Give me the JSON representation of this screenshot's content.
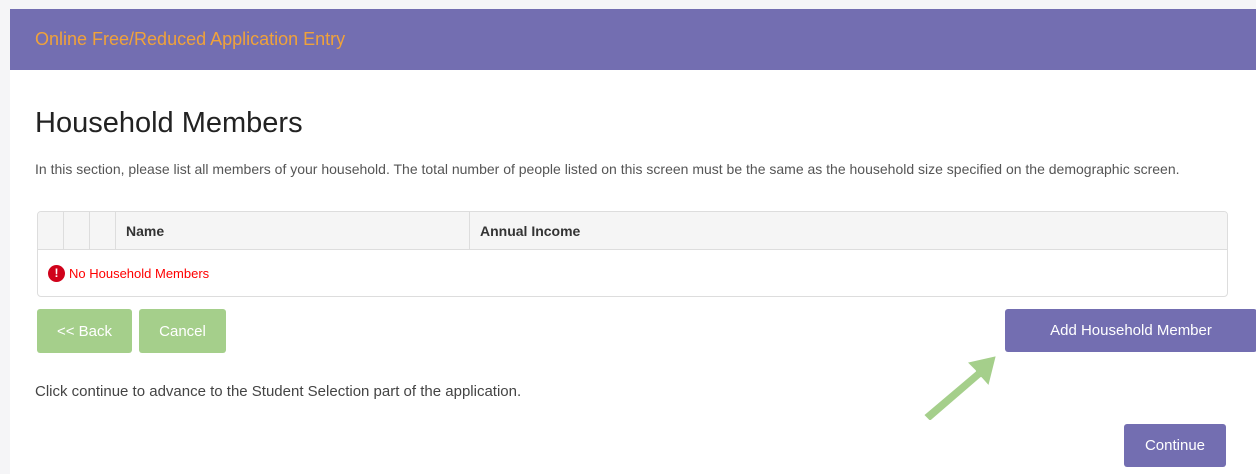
{
  "header": {
    "title": "Online Free/Reduced Application Entry"
  },
  "page": {
    "title": "Household Members",
    "intro": "In this section, please list all members of your household. The total number of people listed on this screen must be the same as the household size specified on the demographic screen.",
    "hint": "Click continue to advance to the Student Selection part of the application."
  },
  "grid": {
    "columns": [
      "",
      "",
      "Name",
      "Annual Income"
    ],
    "empty_message": "No Household Members",
    "empty_icon": "alert-circle-icon"
  },
  "buttons": {
    "back": "<< Back",
    "cancel": "Cancel",
    "add_member": "Add Household Member",
    "continue": "Continue"
  },
  "colors": {
    "header_bg": "#736eb1",
    "header_text": "#f0a23a",
    "primary": "#736eb1",
    "secondary": "#a5cf8b",
    "error": "#ff0000",
    "arrow": "#a5cf8b"
  }
}
